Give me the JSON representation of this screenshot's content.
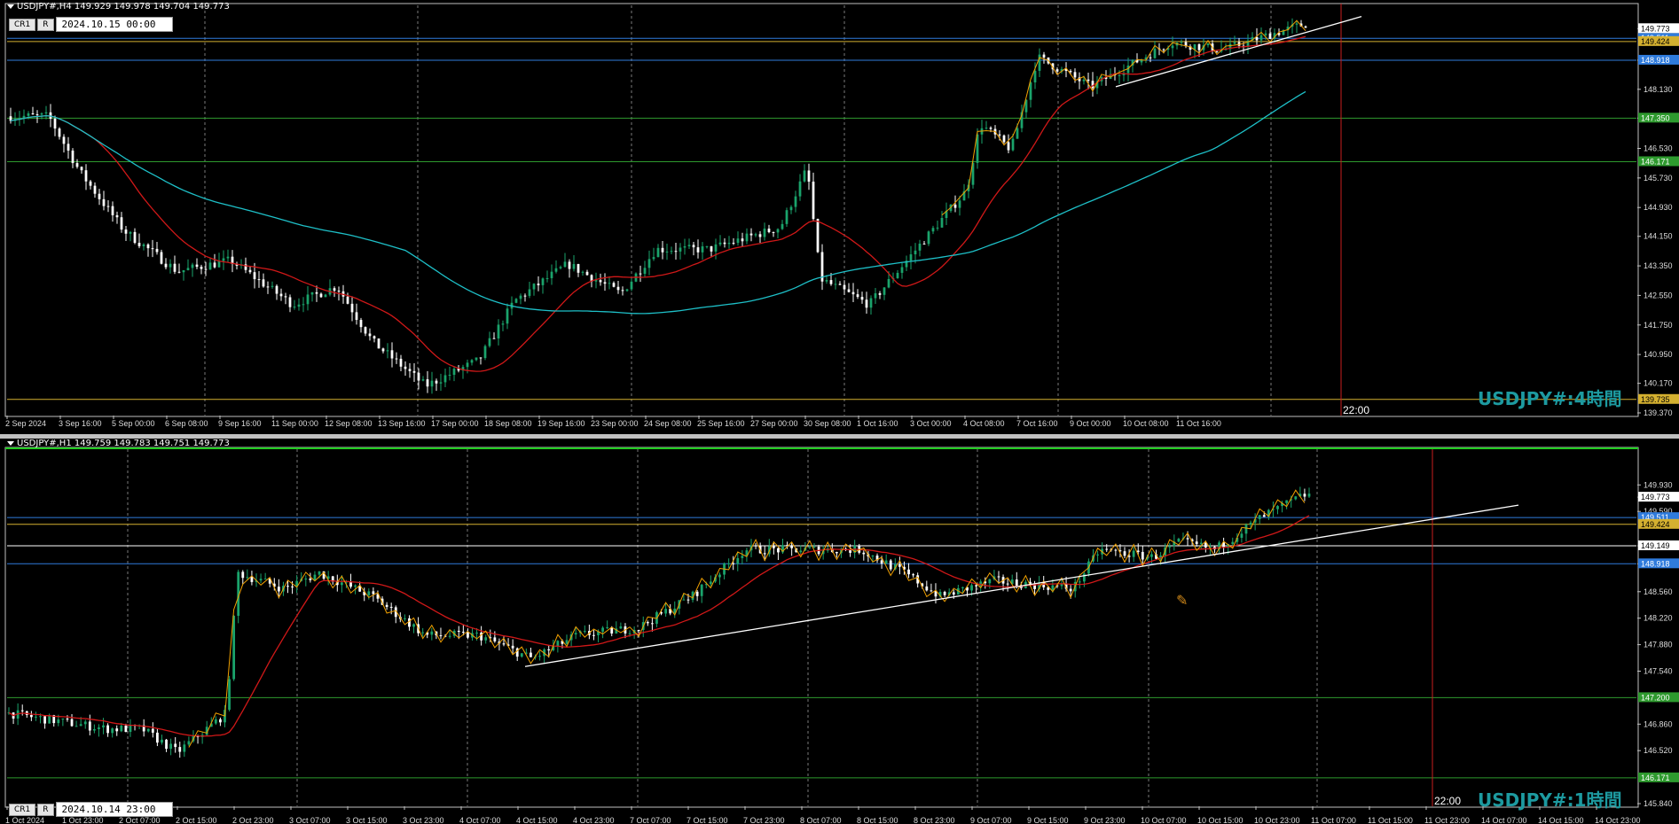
{
  "top": {
    "header": "USDJPY#,H4  149.929 149.978 149.704 149.773",
    "buttons": {
      "cr": "CR1",
      "r": "R"
    },
    "date_value": "2024.10.15 00:00",
    "watermark": "USDJPY#:4時間",
    "vline_label": "22:00",
    "yaxis": {
      "min": 139.37,
      "max": 150.26,
      "ticks": [
        "149.773",
        "148.918",
        "148.130",
        "147.350",
        "146.530",
        "145.730",
        "144.930",
        "144.150",
        "143.350",
        "142.550",
        "141.750",
        "140.950",
        "140.170",
        "139.370"
      ],
      "tick_values": [
        149.773,
        148.918,
        148.13,
        147.35,
        146.53,
        145.73,
        144.93,
        144.15,
        143.35,
        142.55,
        141.75,
        140.95,
        140.17,
        139.37
      ]
    },
    "hlines": [
      {
        "value": 149.511,
        "label": "149.511",
        "color": "#2f7bdc"
      },
      {
        "value": 149.424,
        "label": "149.424",
        "color": "#d4b030"
      },
      {
        "value": 148.918,
        "label": "148.918",
        "color": "#2f7bdc"
      },
      {
        "value": 147.35,
        "label": "147.350",
        "color": "#2e9a2e"
      },
      {
        "value": 146.171,
        "label": "146.171",
        "color": "#2e9a2e"
      },
      {
        "value": 139.735,
        "label": "139.735",
        "color": "#d4b030"
      }
    ],
    "price_badge": "149.773",
    "xaxis": [
      "2 Sep 2024",
      "3 Sep 16:00",
      "5 Sep 00:00",
      "6 Sep 08:00",
      "9 Sep 16:00",
      "11 Sep 00:00",
      "12 Sep 08:00",
      "13 Sep 16:00",
      "17 Sep 00:00",
      "18 Sep 08:00",
      "19 Sep 16:00",
      "23 Sep 00:00",
      "24 Sep 08:00",
      "25 Sep 16:00",
      "27 Sep 00:00",
      "30 Sep 08:00",
      "1 Oct 16:00",
      "3 Oct 00:00",
      "4 Oct 08:00",
      "7 Oct 16:00",
      "9 Oct 00:00",
      "10 Oct 08:00",
      "11 Oct 16:00"
    ]
  },
  "bottom": {
    "header": "USDJPY#,H1  149.759 149.783 149.751 149.773",
    "buttons": {
      "cr": "CR1",
      "r": "R"
    },
    "date_value": "2024.10.14 23:00",
    "watermark": "USDJPY#:1時間",
    "vline_label": "22:00",
    "yaxis": {
      "min": 145.84,
      "max": 150.32,
      "ticks": [
        "149.930",
        "149.773",
        "149.590",
        "149.149",
        "148.918",
        "148.560",
        "148.220",
        "147.880",
        "147.540",
        "146.860",
        "146.520",
        "145.840"
      ],
      "tick_values": [
        149.93,
        149.773,
        149.59,
        149.149,
        148.918,
        148.56,
        148.22,
        147.88,
        147.54,
        146.86,
        146.52,
        145.84
      ]
    },
    "hlines": [
      {
        "value": 149.511,
        "label": "149.511",
        "color": "#2f7bdc"
      },
      {
        "value": 149.424,
        "label": "149.424",
        "color": "#d4b030"
      },
      {
        "value": 149.149,
        "label": "149.149",
        "color": "#ffffff"
      },
      {
        "value": 148.918,
        "label": "148.918",
        "color": "#2f7bdc"
      },
      {
        "value": 147.2,
        "label": "147.200",
        "color": "#2e9a2e"
      },
      {
        "value": 146.171,
        "label": "146.171",
        "color": "#2e9a2e"
      }
    ],
    "price_badge": "149.773",
    "xaxis": [
      "1 Oct 2024",
      "1 Oct 23:00",
      "2 Oct 07:00",
      "2 Oct 15:00",
      "2 Oct 23:00",
      "3 Oct 07:00",
      "3 Oct 15:00",
      "3 Oct 23:00",
      "4 Oct 07:00",
      "4 Oct 15:00",
      "4 Oct 23:00",
      "7 Oct 07:00",
      "7 Oct 15:00",
      "7 Oct 23:00",
      "8 Oct 07:00",
      "8 Oct 15:00",
      "8 Oct 23:00",
      "9 Oct 07:00",
      "9 Oct 15:00",
      "9 Oct 23:00",
      "10 Oct 07:00",
      "10 Oct 15:00",
      "10 Oct 23:00",
      "11 Oct 07:00",
      "11 Oct 15:00",
      "11 Oct 23:00",
      "14 Oct 07:00",
      "14 Oct 15:00",
      "14 Oct 23:00"
    ]
  },
  "colors": {
    "bull": "#1aa36b",
    "bear": "#ffffff",
    "ma_red": "#d01818",
    "ma_cyan": "#1ec0c8",
    "zigzag": "#f0a000",
    "trend": "#ffffff",
    "grid": "#7a7a7a",
    "vline": "#c81e1e"
  }
}
